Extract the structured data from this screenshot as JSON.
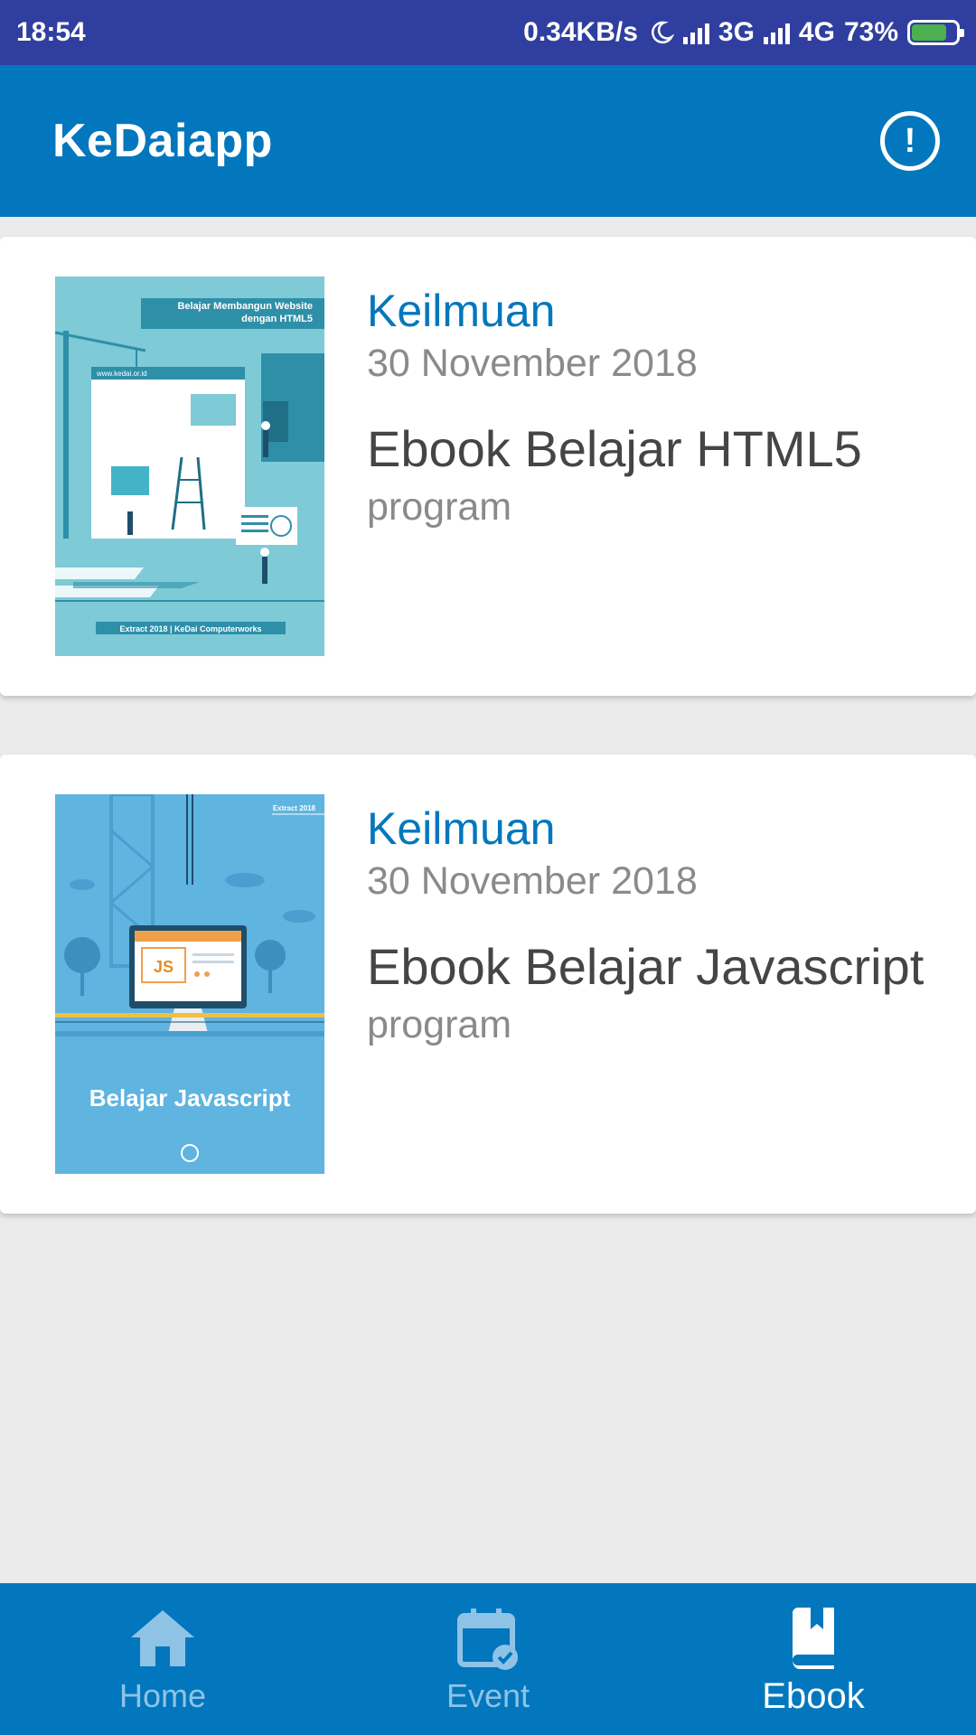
{
  "status_bar": {
    "time": "18:54",
    "speed": "0.34KB/s",
    "net1": "3G",
    "net2": "4G",
    "battery": "73%"
  },
  "app_bar": {
    "title": "KeDaiapp",
    "info_icon": "info-icon"
  },
  "ebooks": [
    {
      "category": "Keilmuan",
      "date": "30 November 2018",
      "title": "Ebook Belajar HTML5",
      "type": "program",
      "cover": {
        "header": "Belajar Membangun Website dengan HTML5",
        "url": "www.kedai.or.id",
        "footer": "Extract 2018 | KeDai Computerworks"
      }
    },
    {
      "category": "Keilmuan",
      "date": "30 November 2018",
      "title": "Ebook Belajar Javascript",
      "type": "program",
      "cover": {
        "tag": "Extract 2018",
        "badge": "JS",
        "caption": "Belajar Javascript"
      }
    }
  ],
  "bottom_nav": {
    "items": [
      {
        "label": "Home",
        "icon": "home-icon",
        "active": false
      },
      {
        "label": "Event",
        "icon": "calendar-icon",
        "active": false
      },
      {
        "label": "Ebook",
        "icon": "book-icon",
        "active": true
      }
    ]
  },
  "colors": {
    "status_bar": "#303f9f",
    "primary": "#0277bd",
    "background": "#ebebeb",
    "nav_inactive": "#8ec3e6"
  }
}
